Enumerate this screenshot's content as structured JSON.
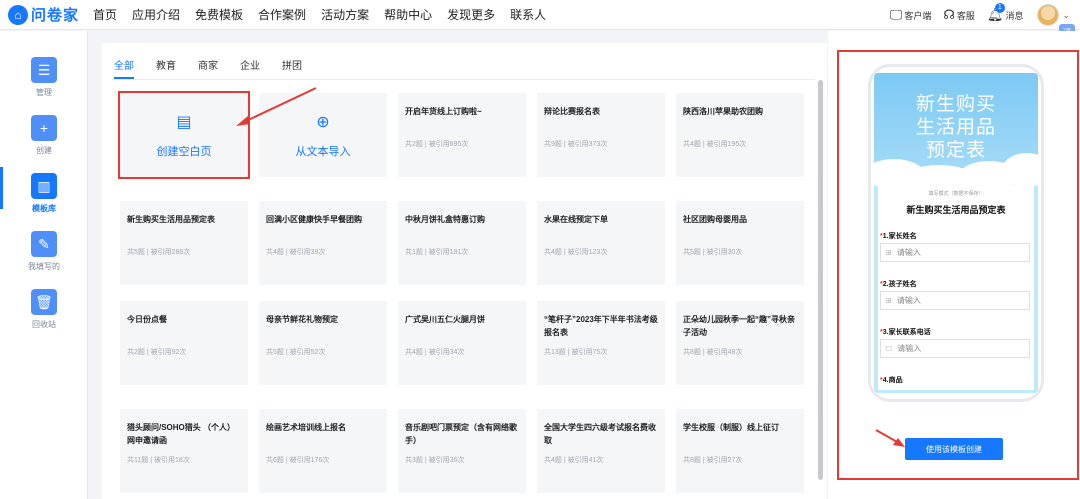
{
  "brand": {
    "logo_glyph": "⌂",
    "name": "问卷家"
  },
  "nav": [
    "首页",
    "应用介绍",
    "免费模板",
    "合作案例",
    "活动方案",
    "帮助中心",
    "发现更多",
    "联系人"
  ],
  "topright": {
    "client_label": "客户端",
    "service_label": "客服",
    "message_label": "消息",
    "message_badge": "1",
    "translate_label": "译"
  },
  "sidebar": [
    {
      "label": "管理",
      "icon": "list-icon",
      "color": "#4f8ff7"
    },
    {
      "label": "创建",
      "icon": "plus-icon",
      "color": "#4f8ff7"
    },
    {
      "label": "模板库",
      "icon": "books-icon",
      "color": "#1677ff",
      "active": true
    },
    {
      "label": "我填写的",
      "icon": "pencil-icon",
      "color": "#4f8ff7"
    },
    {
      "label": "回收站",
      "icon": "trash-icon",
      "color": "#4f8ff7"
    }
  ],
  "tabs": [
    "全部",
    "教育",
    "商家",
    "企业",
    "拼团"
  ],
  "create_cards": [
    {
      "label": "创建空白页",
      "icon": "word-doc-icon"
    },
    {
      "label": "从文本导入",
      "icon": "text-import-icon"
    }
  ],
  "cards": [
    {
      "title": "开启年货线上订购啦~",
      "meta": "共2题 | 被引用695次"
    },
    {
      "title": "辩论比赛报名表",
      "meta": "共9题 | 被引用373次"
    },
    {
      "title": "陕西洛川苹果助农团购",
      "meta": "共4题 | 被引用195次"
    },
    {
      "title": "新生购买生活用品预定表",
      "meta": "共5题 | 被引用288次"
    },
    {
      "title": "回满小区健康快手早餐团购",
      "meta": "共4题 | 被引用39次"
    },
    {
      "title": "中秋月饼礼盒特惠订购",
      "meta": "共1题 | 被引用181次"
    },
    {
      "title": "水果在线预定下单",
      "meta": "共4题 | 被引用123次"
    },
    {
      "title": "社区团购母婴用品",
      "meta": "共5题 | 被引用30次"
    },
    {
      "title": "今日份点餐",
      "meta": "共2题 | 被引用92次"
    },
    {
      "title": "母亲节鲜花礼物预定",
      "meta": "共5题 | 被引用52次"
    },
    {
      "title": "广式吴川五仁火腿月饼",
      "meta": "共4题 | 被引用34次"
    },
    {
      "title": "“笔杆子”2023年下半年书法考级报名表",
      "meta": "共13题 | 被引用75次"
    },
    {
      "title": "正朵幼儿园秋季一起“趣”寻秋亲子活动",
      "meta": "共8题 | 被引用48次"
    },
    {
      "title": "猎头顾问/SOHO猎头 （个人）网申邀请函",
      "meta": "共11题 | 被引用18次"
    },
    {
      "title": "绘画艺术培训线上报名",
      "meta": "共6题 | 被引用176次"
    },
    {
      "title": "音乐剧吧门票预定（含有网络歌手）",
      "meta": "共3题 | 被引用36次"
    },
    {
      "title": "全国大学生四六级考试报名费收取",
      "meta": "共4题 | 被引用41次"
    },
    {
      "title": "学生校服（制服）线上征订",
      "meta": "共8题 | 被引用27次"
    }
  ],
  "preview": {
    "hero_title_line1": "新生购买",
    "hero_title_line2": "生活用品",
    "hero_title_line3": "预定表",
    "hint": "填写模式（数据不保存）",
    "form_title": "新生购买生活用品预定表",
    "questions": [
      {
        "label": "1.家长姓名",
        "placeholder": "请输入",
        "prefix": "⊞"
      },
      {
        "label": "2.孩子姓名",
        "placeholder": "请输入",
        "prefix": "⊞"
      },
      {
        "label": "3.家长联系电话",
        "placeholder": "请输入",
        "prefix": "☐"
      },
      {
        "label": "4.商品",
        "placeholder": "",
        "prefix": ""
      }
    ],
    "use_button": "使用该模板创建"
  }
}
